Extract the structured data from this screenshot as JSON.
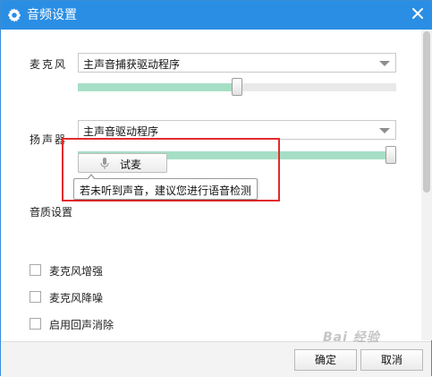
{
  "window": {
    "title": "音频设置"
  },
  "microphone": {
    "label": "麦克风",
    "device": "主声音捕获驱动程序",
    "volume": 0.5
  },
  "speaker": {
    "label": "扬声器",
    "device": "主声音驱动程序",
    "volume": 1.0
  },
  "test": {
    "button_label": "试麦",
    "tooltip": "若未听到声音，建议您进行语音检测"
  },
  "quality": {
    "title": "音质设置",
    "options": [
      {
        "label": "麦克风增强",
        "checked": false
      },
      {
        "label": "麦克风降噪",
        "checked": false
      },
      {
        "label": "启用回声消除",
        "checked": false
      }
    ]
  },
  "footer": {
    "ok_label": "确定",
    "cancel_label": "取消"
  },
  "watermark": "Bai 经验",
  "colors": {
    "titlebar": "#2a8ee4",
    "slider_fill": "#a6dfc5",
    "highlight_box": "#e32b2b"
  }
}
